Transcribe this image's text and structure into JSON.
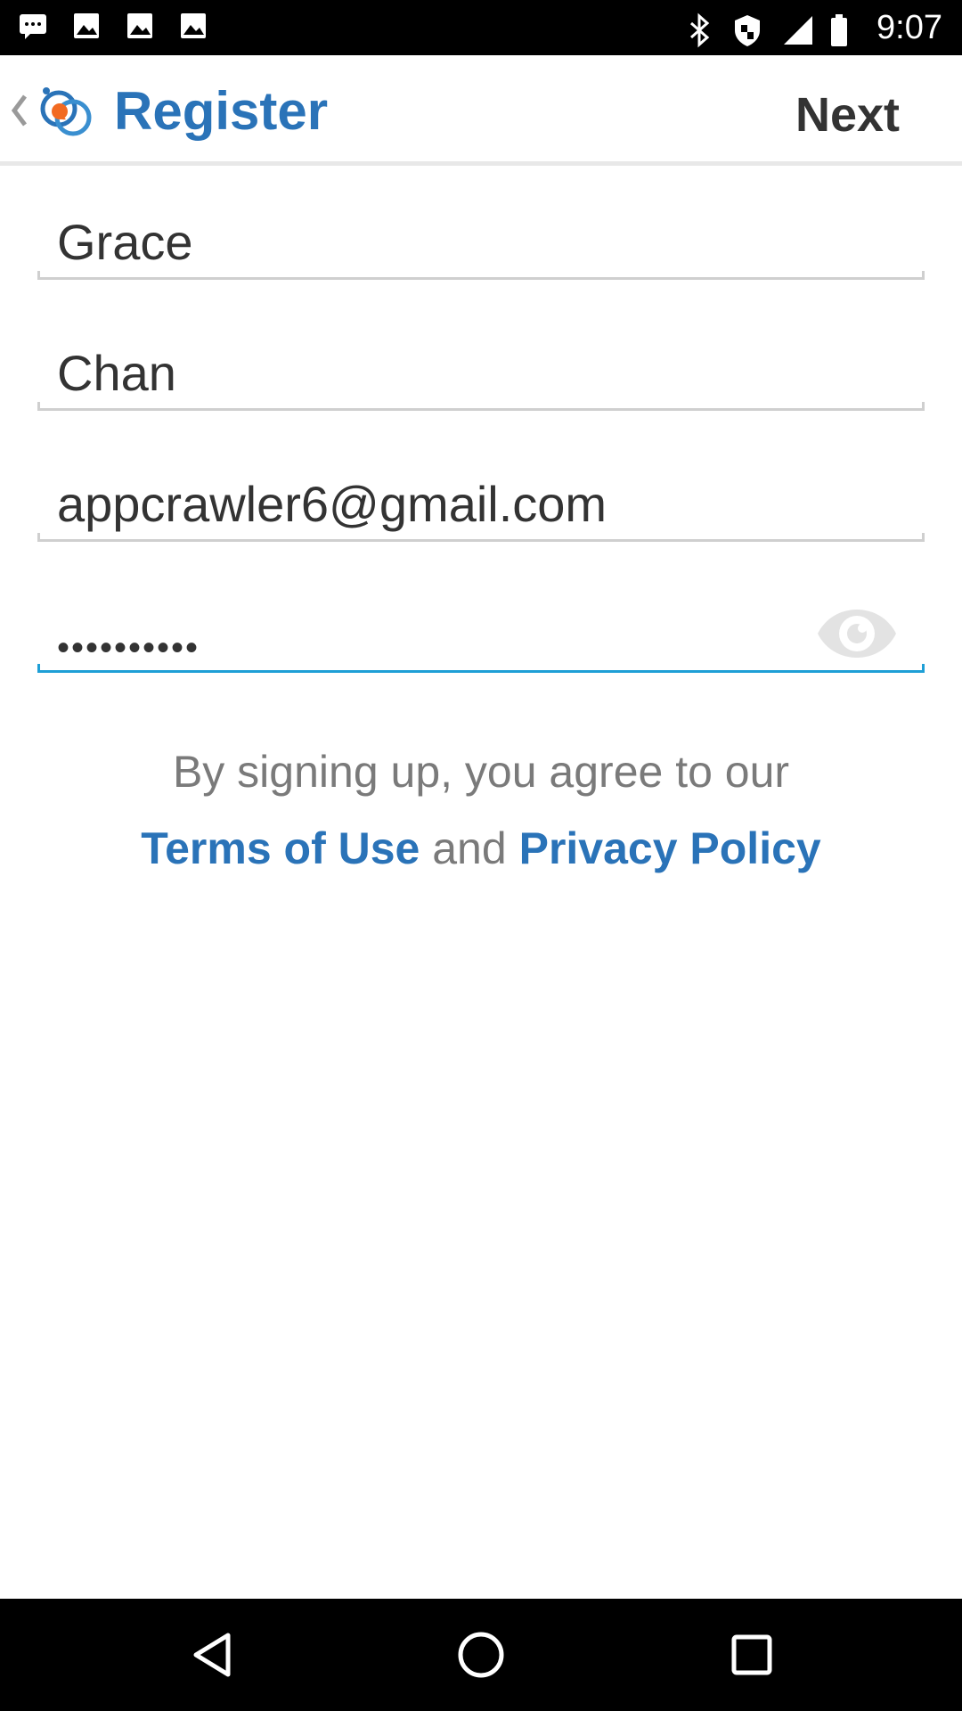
{
  "status_bar": {
    "time": "9:07",
    "left_icons": [
      "messages-icon",
      "image-icon",
      "image-icon",
      "image-icon"
    ],
    "right_icons": [
      "bluetooth-icon",
      "shield-icon",
      "signal-icon",
      "battery-icon"
    ]
  },
  "app_bar": {
    "title": "Register",
    "next_label": "Next",
    "back_icon": "chevron-left-icon",
    "logo_icon": "app-logo-icon"
  },
  "form": {
    "first_name": "Grace",
    "last_name": "Chan",
    "email": "appcrawler6@gmail.com",
    "password_masked": "••••••••••",
    "show_password_icon": "eye-icon"
  },
  "agreement": {
    "line1": "By signing up, you agree to our",
    "terms_label": "Terms of Use",
    "and_label": "and",
    "privacy_label": "Privacy Policy"
  },
  "nav": {
    "back_icon": "triangle-back-icon",
    "home_icon": "circle-home-icon",
    "recents_icon": "square-recents-icon"
  },
  "colors": {
    "accent": "#2a73b8",
    "active_underline": "#1e9fd6",
    "text": "#333333",
    "muted": "#7a7a7a"
  }
}
